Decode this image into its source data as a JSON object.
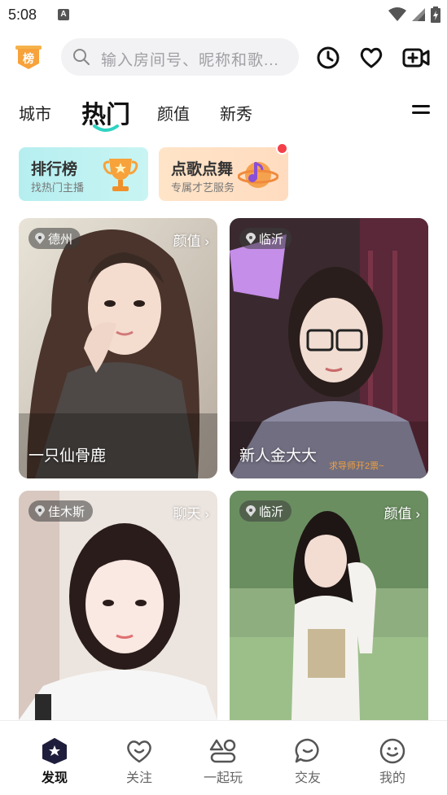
{
  "status_bar": {
    "time": "5:08",
    "notification_letter": "A"
  },
  "header": {
    "badge_text": "榜",
    "search_placeholder": "输入房间号、昵称和歌...",
    "history_icon": "clock-icon",
    "favorite_icon": "heart-icon",
    "live_icon": "video-plus-icon"
  },
  "tabs": [
    {
      "label": "城市"
    },
    {
      "label": "热门"
    },
    {
      "label": "颜值"
    },
    {
      "label": "新秀"
    }
  ],
  "features": [
    {
      "title": "排行榜",
      "subtitle": "找热门主播"
    },
    {
      "title": "点歌点舞",
      "subtitle": "专属才艺服务"
    }
  ],
  "cards": [
    {
      "location": "德州",
      "category": "颜值 ›",
      "name": "一只仙骨鹿"
    },
    {
      "location": "临沂",
      "category": "",
      "name": "新人金大大",
      "overlay_text": "求导师开2票~"
    },
    {
      "location": "佳木斯",
      "category": "聊天 ›",
      "name": ""
    },
    {
      "location": "临沂",
      "category": "颜值 ›",
      "name": ""
    }
  ],
  "bottom_nav": [
    {
      "label": "发现",
      "icon": "discover-star-icon"
    },
    {
      "label": "关注",
      "icon": "heart-smile-icon"
    },
    {
      "label": "一起玩",
      "icon": "shapes-icon"
    },
    {
      "label": "交友",
      "icon": "chat-bubble-icon"
    },
    {
      "label": "我的",
      "icon": "smiley-icon"
    }
  ],
  "colors": {
    "accent": "#2fd3c1",
    "badge": "#f7a23a",
    "notification": "#f4404a"
  }
}
